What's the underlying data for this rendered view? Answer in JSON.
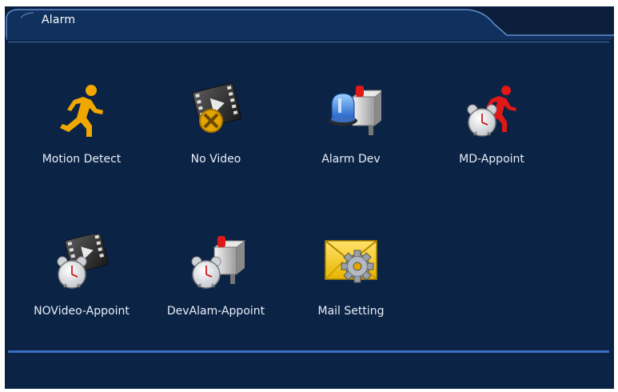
{
  "window": {
    "title": "Alarm"
  },
  "items": [
    {
      "label": "Motion Detect",
      "icon": "running-man-icon"
    },
    {
      "label": "No Video",
      "icon": "film-no-video-icon"
    },
    {
      "label": "Alarm Dev",
      "icon": "alarm-device-icon"
    },
    {
      "label": "MD-Appoint",
      "icon": "clock-running-man-icon"
    },
    {
      "label": "NOVideo-Appoint",
      "icon": "clock-film-icon"
    },
    {
      "label": "DevAlam-Appoint",
      "icon": "clock-alarm-device-icon"
    },
    {
      "label": "Mail Setting",
      "icon": "mail-gear-icon"
    }
  ],
  "colors": {
    "background": "#0b2345",
    "tab": "#0e2a55",
    "accent_line": "#3a6ec2",
    "motion": "#f0a800",
    "md_appoint": "#e01818"
  }
}
